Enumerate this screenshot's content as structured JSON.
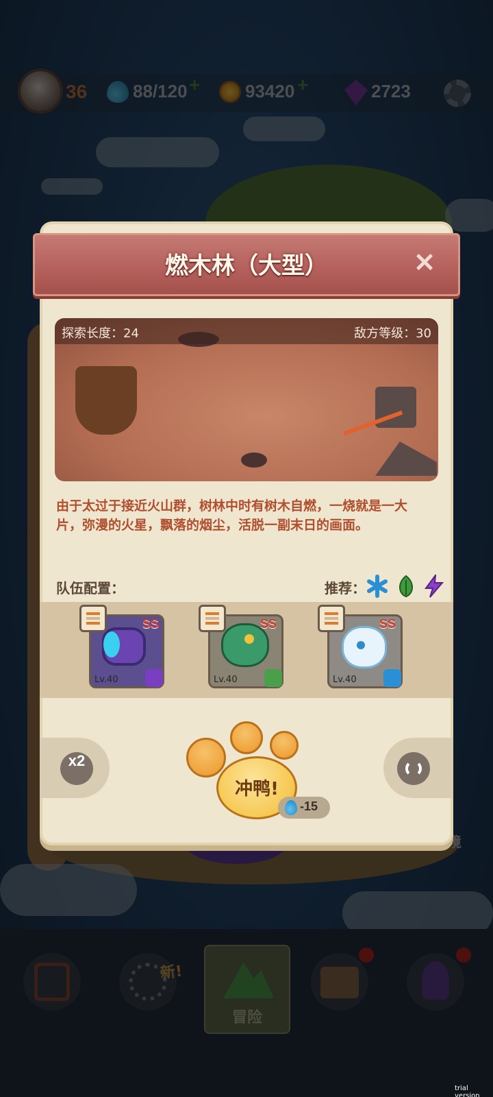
{
  "hud": {
    "player_level": "36",
    "energy": "88/120",
    "coins": "93420",
    "gems": "2723",
    "plus": "+"
  },
  "dialog": {
    "title": "燃木林（大型）",
    "close": "✕",
    "stage": {
      "explore_length": "探索长度：24",
      "enemy_level": "敌方等级：30"
    },
    "description_line1": "由于太过于接近火山群，树林中时有树木自燃，一烧就是一大",
    "description_line2": "片，弥漫的火星，飘落的烟尘，活脱一副末日的画面。",
    "team_label": "队伍配置：",
    "recommend_label": "推荐：",
    "recommend_icons": [
      "ice-element-icon",
      "leaf-element-icon",
      "lightning-element-icon"
    ],
    "team": [
      {
        "rank": "SS",
        "level": "Lv.40",
        "element": "lightning",
        "name": "cannon"
      },
      {
        "rank": "SS",
        "level": "Lv.40",
        "element": "leaf",
        "name": "snake"
      },
      {
        "rank": "SS",
        "level": "Lv.40",
        "element": "ice",
        "name": "spirit"
      }
    ],
    "speed_button": "x2",
    "go_button": "冲鸭!",
    "cost": "-15"
  },
  "nav": {
    "new_badge": "新!",
    "adventure_label": "冒险"
  },
  "side_label": "境",
  "watermark": "trial version",
  "colors": {
    "title_band": "#b6615d",
    "dialog_bg": "#efe6cf",
    "description_text": "#b14e2e",
    "paw_orange": "#f0a33d",
    "rank_red": "#d23b2a"
  }
}
